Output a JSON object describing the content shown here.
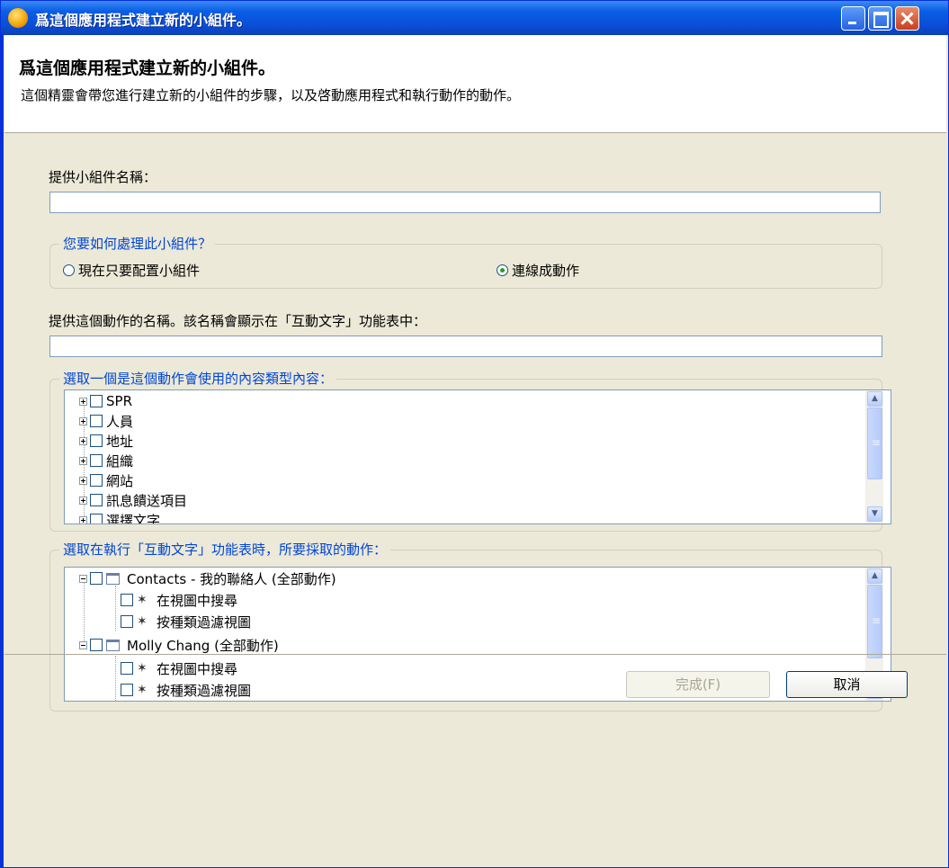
{
  "window": {
    "title": "爲這個應用程式建立新的小組件。"
  },
  "header": {
    "title": "爲這個應用程式建立新的小組件。",
    "description": "這個精靈會帶您進行建立新的小組件的步驟，以及啓動應用程式和執行動作的動作。"
  },
  "widget_name": {
    "label": "提供小組件名稱：",
    "value": ""
  },
  "handling": {
    "legend": "您要如何處理此小組件？",
    "options": [
      {
        "label": "現在只要配置小組件",
        "selected": false
      },
      {
        "label": "連線成動作",
        "selected": true
      }
    ]
  },
  "action_name": {
    "label": "提供這個動作的名稱。該名稱會顯示在「互動文字」功能表中：",
    "value": ""
  },
  "content_types": {
    "legend": "選取一個是這個動作會使用的內容類型內容：",
    "items": [
      "SPR",
      "人員",
      "地址",
      "組織",
      "網站",
      "訊息饋送項目",
      "選擇文字"
    ]
  },
  "actions": {
    "legend": "選取在執行「互動文字」功能表時，所要採取的動作：",
    "groups": [
      {
        "label": "Contacts - 我的聯絡人 (全部動作)",
        "children": [
          "在視圖中搜尋",
          "按種類過濾視圖"
        ]
      },
      {
        "label": "Molly Chang (全部動作)",
        "children": [
          "在視圖中搜尋",
          "按種類過濾視圖"
        ]
      }
    ]
  },
  "buttons": {
    "finish": "完成(F)",
    "cancel": "取消"
  }
}
